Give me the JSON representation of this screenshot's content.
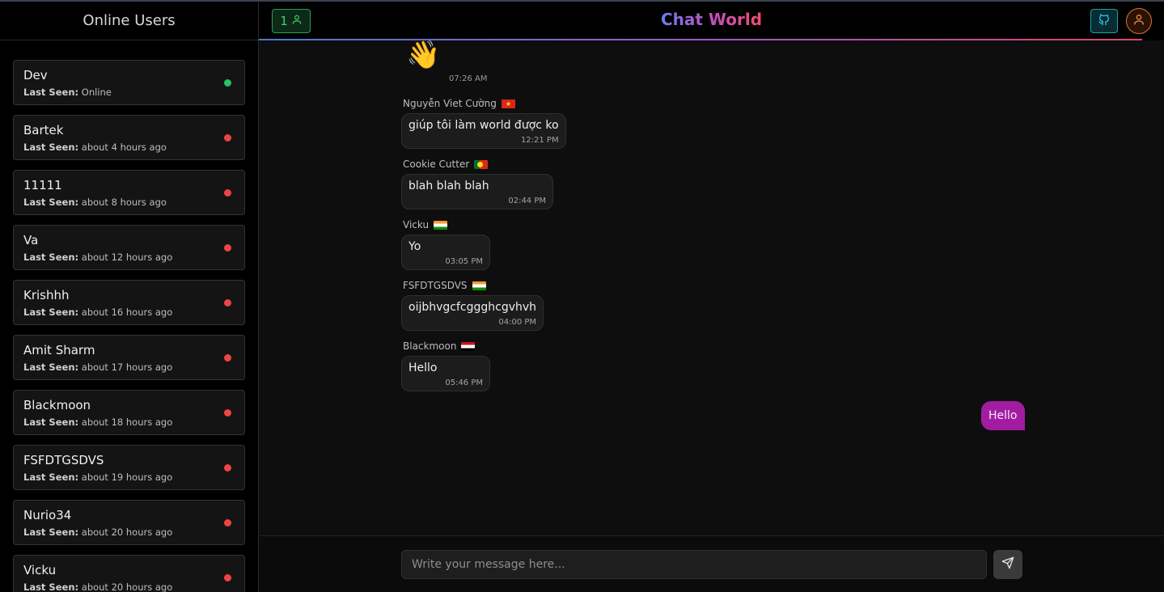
{
  "sidebar": {
    "title": "Online Users",
    "last_seen_label": "Last Seen:",
    "users": [
      {
        "name": "Dev",
        "last_seen": "Online",
        "status": "online"
      },
      {
        "name": "Bartek",
        "last_seen": "about 4 hours ago",
        "status": "offline"
      },
      {
        "name": "11111",
        "last_seen": "about 8 hours ago",
        "status": "offline"
      },
      {
        "name": "Va",
        "last_seen": "about 12 hours ago",
        "status": "offline"
      },
      {
        "name": "Krishhh",
        "last_seen": "about 16 hours ago",
        "status": "offline"
      },
      {
        "name": "Amit Sharm",
        "last_seen": "about 17 hours ago",
        "status": "offline"
      },
      {
        "name": "Blackmoon",
        "last_seen": "about 18 hours ago",
        "status": "offline"
      },
      {
        "name": "FSFDTGSDVS",
        "last_seen": "about 19 hours ago",
        "status": "offline"
      },
      {
        "name": "Nurio34",
        "last_seen": "about 20 hours ago",
        "status": "offline"
      },
      {
        "name": "Vicku",
        "last_seen": "about 20 hours ago",
        "status": "offline"
      }
    ]
  },
  "header": {
    "online_count": "1",
    "title": "Chat World",
    "user_icon": "user-icon",
    "github_icon": "github-icon",
    "avatar_icon": "profile-icon"
  },
  "colors": {
    "online": "#22c55e",
    "offline": "#ef4444",
    "own_bubble": "#a21ca2"
  },
  "chat": {
    "wave_emoji": "👋",
    "wave_time": "07:26 AM",
    "messages": [
      {
        "sender": "Nguyễn Viet Cường",
        "flag": "vietnam-flag",
        "text": "giúp tôi làm world được ko",
        "time": "12:21 PM"
      },
      {
        "sender": "Cookie Cutter",
        "flag": "portugal-flag",
        "text": "blah blah blah",
        "time": "02:44 PM"
      },
      {
        "sender": "Vicku",
        "flag": "india-flag",
        "text": "Yo",
        "time": "03:05 PM"
      },
      {
        "sender": "FSFDTGSDVS",
        "flag": "india-flag",
        "text": "oijbhvgcfcggghcgvhvh",
        "time": "04:00 PM"
      },
      {
        "sender": "Blackmoon",
        "flag": "egypt-flag",
        "text": "Hello",
        "time": "05:46 PM"
      }
    ],
    "own_message": "Hello"
  },
  "composer": {
    "placeholder": "Write your message here...",
    "value": "",
    "send_icon": "send-icon"
  }
}
